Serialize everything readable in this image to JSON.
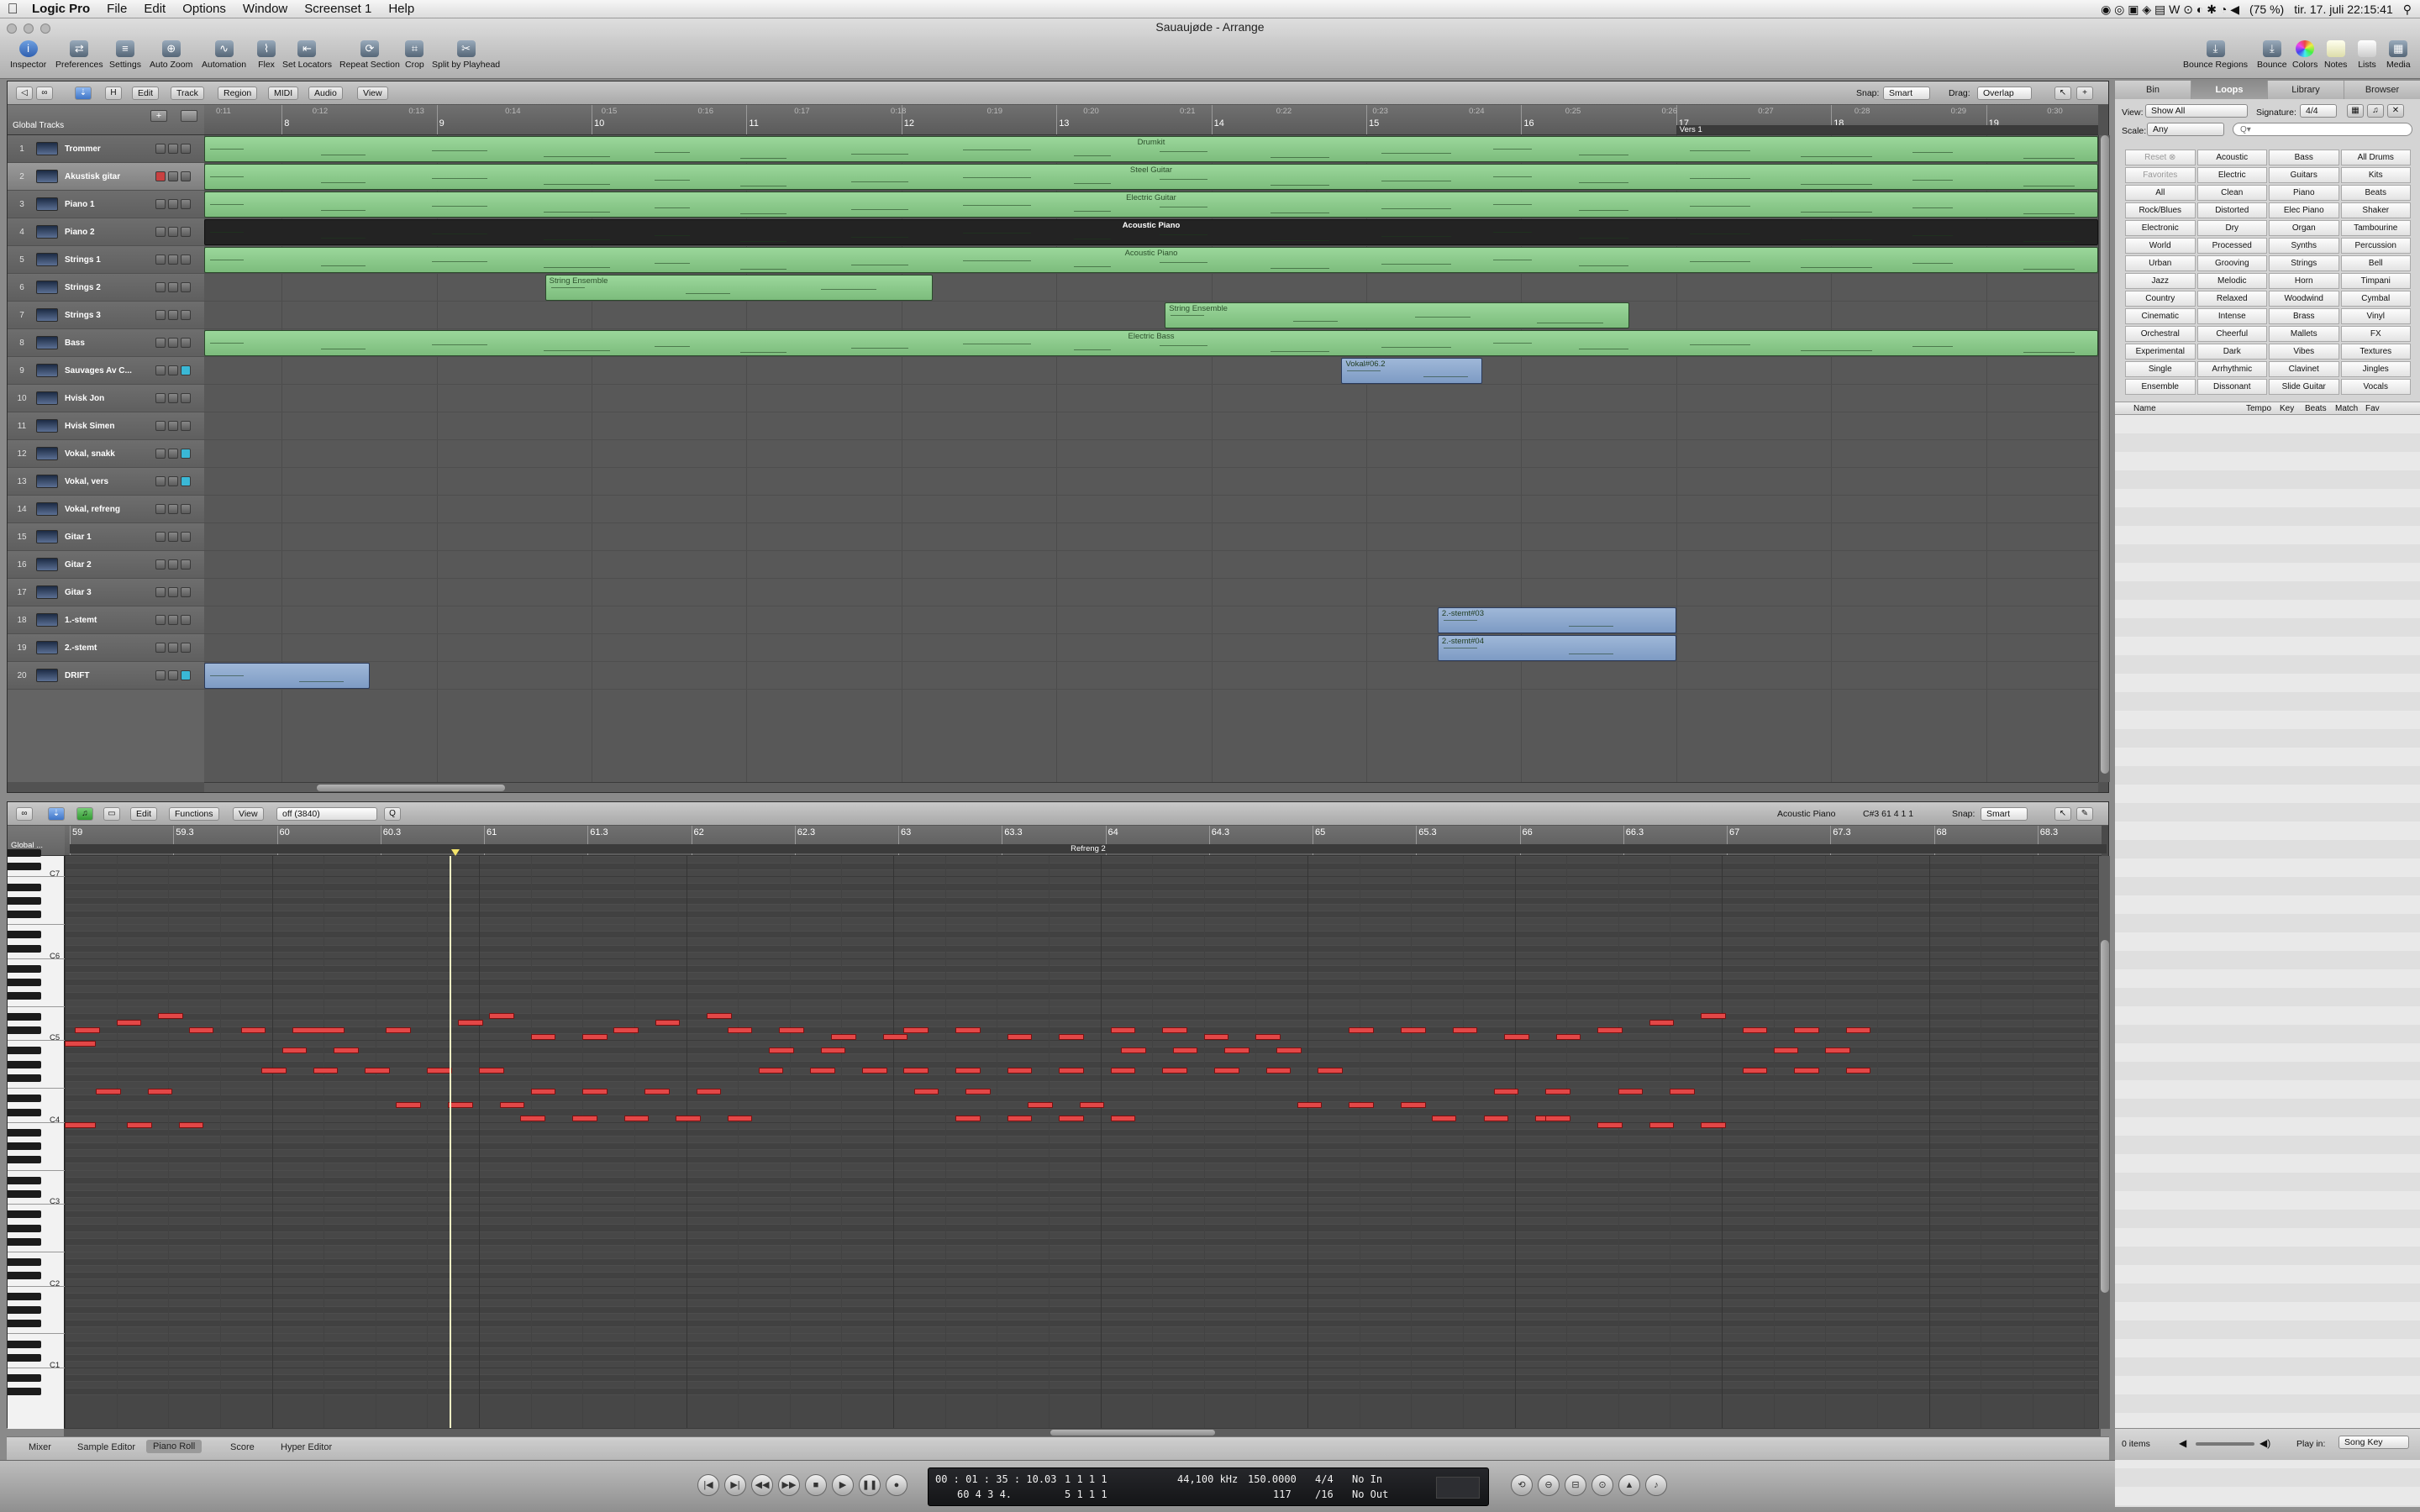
{
  "menubar": {
    "app": "Logic Pro",
    "items": [
      "File",
      "Edit",
      "Options",
      "Window",
      "Screenset 1",
      "Help"
    ],
    "battery": "(75 %)",
    "datetime": "tir. 17. juli  22:15:41"
  },
  "window": {
    "title": "Sauaujøde - Arrange"
  },
  "toolbar": {
    "left": [
      "Inspector",
      "Preferences",
      "Settings",
      "Auto Zoom",
      "Automation",
      "Flex",
      "Set Locators",
      "Repeat Section",
      "Crop",
      "Split by Playhead"
    ],
    "right": [
      "Bounce Regions",
      "Bounce",
      "Colors",
      "Notes",
      "Lists",
      "Media"
    ]
  },
  "arrange": {
    "menus": [
      "Edit",
      "Track",
      "Region",
      "MIDI",
      "Audio",
      "View"
    ],
    "snap_label": "Snap:",
    "snap_value": "Smart",
    "drag_label": "Drag:",
    "drag_value": "Overlap",
    "global_tracks": "Global Tracks",
    "ruler_bars": [
      "8",
      "9",
      "10",
      "11",
      "12",
      "13",
      "14",
      "15",
      "16",
      "17",
      "18",
      "19"
    ],
    "ruler_times": [
      "0:11",
      "0:12",
      "0:13",
      "0:14",
      "0:15",
      "0:16",
      "0:17",
      "0:18",
      "0:19",
      "0:20",
      "0:21",
      "0:22",
      "0:23",
      "0:24",
      "0:25",
      "0:26",
      "0:27",
      "0:28",
      "0:29",
      "0:30"
    ],
    "marker": "Vers 1",
    "tracks": [
      {
        "num": "1",
        "name": "Trommer"
      },
      {
        "num": "2",
        "name": "Akustisk gitar"
      },
      {
        "num": "3",
        "name": "Piano 1"
      },
      {
        "num": "4",
        "name": "Piano 2"
      },
      {
        "num": "5",
        "name": "Strings 1"
      },
      {
        "num": "6",
        "name": "Strings 2"
      },
      {
        "num": "7",
        "name": "Strings 3"
      },
      {
        "num": "8",
        "name": "Bass"
      },
      {
        "num": "9",
        "name": "Sauvages Av C..."
      },
      {
        "num": "10",
        "name": "Hvisk Jon"
      },
      {
        "num": "11",
        "name": "Hvisk Simen"
      },
      {
        "num": "12",
        "name": "Vokal, snakk"
      },
      {
        "num": "13",
        "name": "Vokal, vers"
      },
      {
        "num": "14",
        "name": "Vokal, refreng"
      },
      {
        "num": "15",
        "name": "Gitar 1"
      },
      {
        "num": "16",
        "name": "Gitar 2"
      },
      {
        "num": "17",
        "name": "Gitar 3"
      },
      {
        "num": "18",
        "name": "1.-stemt"
      },
      {
        "num": "19",
        "name": "2.-stemt"
      },
      {
        "num": "20",
        "name": "DRIFT"
      }
    ],
    "regions": [
      {
        "track": 0,
        "start_bar": 7.5,
        "end_bar": 19.95,
        "name": "Drumkit",
        "color": "green"
      },
      {
        "track": 1,
        "start_bar": 7.5,
        "end_bar": 19.95,
        "name": "Steel Guitar",
        "color": "green"
      },
      {
        "track": 2,
        "start_bar": 7.5,
        "end_bar": 19.95,
        "name": "Electric Guitar",
        "color": "green"
      },
      {
        "track": 3,
        "start_bar": 7.5,
        "end_bar": 19.95,
        "name": "Acoustic Piano",
        "color": "dark"
      },
      {
        "track": 4,
        "start_bar": 7.5,
        "end_bar": 19.95,
        "name": "Acoustic Piano",
        "color": "green"
      },
      {
        "track": 5,
        "start_bar": 9.7,
        "end_bar": 12.2,
        "name": "String Ensemble",
        "color": "green"
      },
      {
        "track": 6,
        "start_bar": 13.7,
        "end_bar": 16.7,
        "name": "String Ensemble",
        "color": "green"
      },
      {
        "track": 7,
        "start_bar": 7.5,
        "end_bar": 19.95,
        "name": "Electric Bass",
        "color": "green"
      },
      {
        "track": 8,
        "start_bar": 14.84,
        "end_bar": 15.75,
        "name": "Vokal#06.2",
        "color": "blue"
      },
      {
        "track": 17,
        "start_bar": 15.46,
        "end_bar": 17.0,
        "name": "2.-stemt#03",
        "color": "blue"
      },
      {
        "track": 18,
        "start_bar": 15.46,
        "end_bar": 17.0,
        "name": "2.-stemt#04",
        "color": "blue"
      },
      {
        "track": 19,
        "start_bar": 7.5,
        "end_bar": 8.57,
        "name": "",
        "color": "blue"
      }
    ]
  },
  "pianoroll": {
    "menus": [
      "Edit",
      "Functions",
      "View"
    ],
    "quantize": "off (3840)",
    "region_label": "Acoustic Piano",
    "position": "C#3   61 4 1 1",
    "snap_label": "Snap:",
    "snap_value": "Smart",
    "global": "Global ...",
    "ruler": [
      "59",
      "59.3",
      "60",
      "60.3",
      "61",
      "61.3",
      "62",
      "62.3",
      "63",
      "63.3",
      "64",
      "64.3",
      "65",
      "65.3",
      "66",
      "66.3",
      "67",
      "67.3",
      "68",
      "68.3"
    ],
    "marker": "Refreng 2",
    "octave_labels": [
      "C7",
      "C6",
      "C5",
      "C4",
      "C3",
      "C2",
      "C1"
    ],
    "notes": [
      {
        "pitch": 73,
        "start": 59.05,
        "len": 0.12
      },
      {
        "pitch": 74,
        "start": 59.25,
        "len": 0.12
      },
      {
        "pitch": 75,
        "start": 59.45,
        "len": 0.12
      },
      {
        "pitch": 71,
        "start": 59.0,
        "len": 0.15
      },
      {
        "pitch": 73,
        "start": 59.6,
        "len": 0.12
      },
      {
        "pitch": 73,
        "start": 59.85,
        "len": 0.12
      },
      {
        "pitch": 73,
        "start": 60.1,
        "len": 0.25
      },
      {
        "pitch": 70,
        "start": 60.05,
        "len": 0.12
      },
      {
        "pitch": 70,
        "start": 60.3,
        "len": 0.12
      },
      {
        "pitch": 67,
        "start": 59.95,
        "len": 0.12
      },
      {
        "pitch": 67,
        "start": 60.2,
        "len": 0.12
      },
      {
        "pitch": 67,
        "start": 60.45,
        "len": 0.12
      },
      {
        "pitch": 64,
        "start": 59.15,
        "len": 0.12
      },
      {
        "pitch": 64,
        "start": 59.4,
        "len": 0.12
      },
      {
        "pitch": 59,
        "start": 59.0,
        "len": 0.15
      },
      {
        "pitch": 59,
        "start": 59.3,
        "len": 0.12
      },
      {
        "pitch": 59,
        "start": 59.55,
        "len": 0.12
      },
      {
        "pitch": 73,
        "start": 60.55,
        "len": 0.12
      },
      {
        "pitch": 74,
        "start": 60.9,
        "len": 0.12
      },
      {
        "pitch": 75,
        "start": 61.05,
        "len": 0.12
      },
      {
        "pitch": 67,
        "start": 60.75,
        "len": 0.12
      },
      {
        "pitch": 67,
        "start": 61.0,
        "len": 0.12
      },
      {
        "pitch": 62,
        "start": 60.6,
        "len": 0.12
      },
      {
        "pitch": 62,
        "start": 60.85,
        "len": 0.12
      },
      {
        "pitch": 62,
        "start": 61.1,
        "len": 0.12
      },
      {
        "pitch": 72,
        "start": 61.25,
        "len": 0.12
      },
      {
        "pitch": 72,
        "start": 61.5,
        "len": 0.12
      },
      {
        "pitch": 73,
        "start": 61.65,
        "len": 0.12
      },
      {
        "pitch": 74,
        "start": 61.85,
        "len": 0.12
      },
      {
        "pitch": 75,
        "start": 62.1,
        "len": 0.12
      },
      {
        "pitch": 64,
        "start": 61.25,
        "len": 0.12
      },
      {
        "pitch": 64,
        "start": 61.5,
        "len": 0.12
      },
      {
        "pitch": 64,
        "start": 61.8,
        "len": 0.12
      },
      {
        "pitch": 64,
        "start": 62.05,
        "len": 0.12
      },
      {
        "pitch": 60,
        "start": 61.2,
        "len": 0.12
      },
      {
        "pitch": 60,
        "start": 61.45,
        "len": 0.12
      },
      {
        "pitch": 60,
        "start": 61.7,
        "len": 0.12
      },
      {
        "pitch": 60,
        "start": 61.95,
        "len": 0.12
      },
      {
        "pitch": 60,
        "start": 62.2,
        "len": 0.12
      },
      {
        "pitch": 73,
        "start": 62.2,
        "len": 0.12
      },
      {
        "pitch": 73,
        "start": 62.45,
        "len": 0.12
      },
      {
        "pitch": 70,
        "start": 62.4,
        "len": 0.12
      },
      {
        "pitch": 70,
        "start": 62.65,
        "len": 0.12
      },
      {
        "pitch": 72,
        "start": 62.7,
        "len": 0.12
      },
      {
        "pitch": 72,
        "start": 62.95,
        "len": 0.12
      },
      {
        "pitch": 67,
        "start": 62.35,
        "len": 0.12
      },
      {
        "pitch": 67,
        "start": 62.6,
        "len": 0.12
      },
      {
        "pitch": 67,
        "start": 62.85,
        "len": 0.12
      },
      {
        "pitch": 73,
        "start": 63.05,
        "len": 0.12
      },
      {
        "pitch": 73,
        "start": 63.3,
        "len": 0.12
      },
      {
        "pitch": 72,
        "start": 63.55,
        "len": 0.12
      },
      {
        "pitch": 72,
        "start": 63.8,
        "len": 0.12
      },
      {
        "pitch": 67,
        "start": 63.05,
        "len": 0.12
      },
      {
        "pitch": 67,
        "start": 63.3,
        "len": 0.12
      },
      {
        "pitch": 67,
        "start": 63.55,
        "len": 0.12
      },
      {
        "pitch": 67,
        "start": 63.8,
        "len": 0.12
      },
      {
        "pitch": 64,
        "start": 63.1,
        "len": 0.12
      },
      {
        "pitch": 64,
        "start": 63.35,
        "len": 0.12
      },
      {
        "pitch": 62,
        "start": 63.65,
        "len": 0.12
      },
      {
        "pitch": 62,
        "start": 63.9,
        "len": 0.12
      },
      {
        "pitch": 60,
        "start": 63.3,
        "len": 0.12
      },
      {
        "pitch": 60,
        "start": 63.55,
        "len": 0.12
      },
      {
        "pitch": 60,
        "start": 63.8,
        "len": 0.12
      },
      {
        "pitch": 60,
        "start": 64.05,
        "len": 0.12
      },
      {
        "pitch": 73,
        "start": 64.05,
        "len": 0.12
      },
      {
        "pitch": 73,
        "start": 64.3,
        "len": 0.12
      },
      {
        "pitch": 72,
        "start": 64.5,
        "len": 0.12
      },
      {
        "pitch": 72,
        "start": 64.75,
        "len": 0.12
      },
      {
        "pitch": 70,
        "start": 64.1,
        "len": 0.12
      },
      {
        "pitch": 70,
        "start": 64.35,
        "len": 0.12
      },
      {
        "pitch": 70,
        "start": 64.6,
        "len": 0.12
      },
      {
        "pitch": 70,
        "start": 64.85,
        "len": 0.12
      },
      {
        "pitch": 67,
        "start": 64.05,
        "len": 0.12
      },
      {
        "pitch": 67,
        "start": 64.3,
        "len": 0.12
      },
      {
        "pitch": 67,
        "start": 64.55,
        "len": 0.12
      },
      {
        "pitch": 67,
        "start": 64.8,
        "len": 0.12
      },
      {
        "pitch": 67,
        "start": 65.05,
        "len": 0.12
      },
      {
        "pitch": 62,
        "start": 64.95,
        "len": 0.12
      },
      {
        "pitch": 62,
        "start": 65.2,
        "len": 0.12
      },
      {
        "pitch": 62,
        "start": 65.45,
        "len": 0.12
      },
      {
        "pitch": 73,
        "start": 65.2,
        "len": 0.12
      },
      {
        "pitch": 73,
        "start": 65.45,
        "len": 0.12
      },
      {
        "pitch": 73,
        "start": 65.7,
        "len": 0.12
      },
      {
        "pitch": 72,
        "start": 65.95,
        "len": 0.12
      },
      {
        "pitch": 72,
        "start": 66.2,
        "len": 0.12
      },
      {
        "pitch": 64,
        "start": 65.9,
        "len": 0.12
      },
      {
        "pitch": 64,
        "start": 66.15,
        "len": 0.12
      },
      {
        "pitch": 60,
        "start": 65.6,
        "len": 0.12
      },
      {
        "pitch": 60,
        "start": 65.85,
        "len": 0.12
      },
      {
        "pitch": 60,
        "start": 66.1,
        "len": 0.12
      },
      {
        "pitch": 73,
        "start": 66.4,
        "len": 0.12
      },
      {
        "pitch": 74,
        "start": 66.65,
        "len": 0.12
      },
      {
        "pitch": 75,
        "start": 66.9,
        "len": 0.12
      },
      {
        "pitch": 73,
        "start": 67.1,
        "len": 0.12
      },
      {
        "pitch": 73,
        "start": 67.35,
        "len": 0.12
      },
      {
        "pitch": 73,
        "start": 67.6,
        "len": 0.12
      },
      {
        "pitch": 70,
        "start": 67.25,
        "len": 0.12
      },
      {
        "pitch": 70,
        "start": 67.5,
        "len": 0.12
      },
      {
        "pitch": 67,
        "start": 67.1,
        "len": 0.12
      },
      {
        "pitch": 67,
        "start": 67.35,
        "len": 0.12
      },
      {
        "pitch": 67,
        "start": 67.6,
        "len": 0.12
      },
      {
        "pitch": 64,
        "start": 66.5,
        "len": 0.12
      },
      {
        "pitch": 64,
        "start": 66.75,
        "len": 0.12
      },
      {
        "pitch": 59,
        "start": 66.4,
        "len": 0.12
      },
      {
        "pitch": 59,
        "start": 66.65,
        "len": 0.12
      },
      {
        "pitch": 59,
        "start": 66.9,
        "len": 0.12
      },
      {
        "pitch": 60,
        "start": 66.15,
        "len": 0.12
      }
    ]
  },
  "bottom_tabs": [
    "Mixer",
    "Sample Editor",
    "Piano Roll",
    "Score",
    "Hyper Editor"
  ],
  "transport": {
    "time": "00 : 01 : 35 : 10.03",
    "time2": "60   4   3   4.",
    "pos1": "1   1   1      1",
    "pos2": "5   1   1      1",
    "rate": "44,100 kHz",
    "tempo": "150.0000",
    "tempo2": "117",
    "sig": "4/4",
    "sig2": "/16",
    "in": "No In",
    "out": "No Out"
  },
  "library": {
    "tabs": [
      "Bin",
      "Loops",
      "Library",
      "Browser"
    ],
    "view_label": "View:",
    "view_value": "Show All",
    "sig_label": "Signature:",
    "sig_value": "4/4",
    "scale_label": "Scale:",
    "scale_value": "Any",
    "search_placeholder": "Q▾",
    "keywords": [
      "Reset ⊗",
      "Acoustic",
      "Bass",
      "All Drums",
      "Favorites",
      "Electric",
      "Guitars",
      "Kits",
      "All",
      "Clean",
      "Piano",
      "Beats",
      "Rock/Blues",
      "Distorted",
      "Elec Piano",
      "Shaker",
      "Electronic",
      "Dry",
      "Organ",
      "Tambourine",
      "World",
      "Processed",
      "Synths",
      "Percussion",
      "Urban",
      "Grooving",
      "Strings",
      "Bell",
      "Jazz",
      "Melodic",
      "Horn",
      "Timpani",
      "Country",
      "Relaxed",
      "Woodwind",
      "Cymbal",
      "Cinematic",
      "Intense",
      "Brass",
      "Vinyl",
      "Orchestral",
      "Cheerful",
      "Mallets",
      "FX",
      "Experimental",
      "Dark",
      "Vibes",
      "Textures",
      "Single",
      "Arrhythmic",
      "Clavinet",
      "Jingles",
      "Ensemble",
      "Dissonant",
      "Slide Guitar",
      "Vocals"
    ],
    "columns": [
      "Name",
      "Tempo",
      "Key",
      "Beats",
      "Match",
      "Fav"
    ],
    "item_count": "0 items",
    "play_in_label": "Play in:",
    "play_in_value": "Song Key"
  }
}
